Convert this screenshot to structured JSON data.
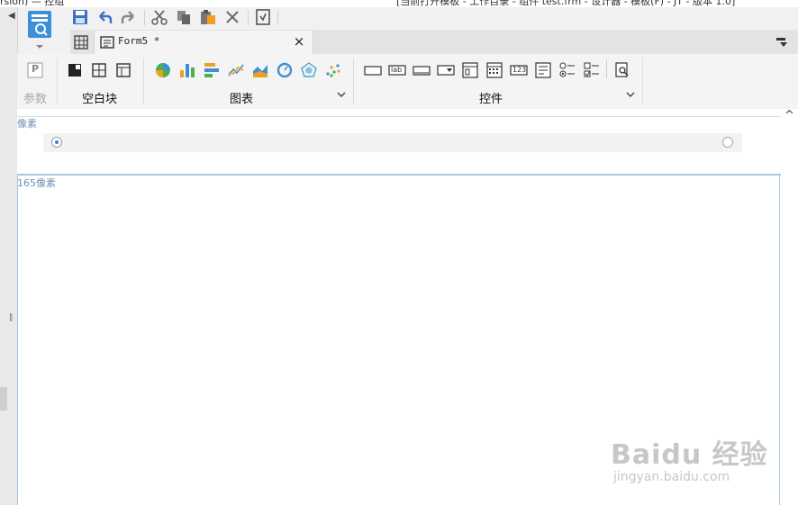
{
  "titlebar": {
    "left_text": "rsion)  — 控组",
    "right_text": "[当前打开模板 - 工作目录 - 组件 test.frm - 设计器 - 模板(F) - JT - 版本 1.0]"
  },
  "tab": {
    "label": "Form5 *",
    "close": "×"
  },
  "ribbon": {
    "param_label": "参数",
    "param_icon_letter": "P",
    "blank_label": "空白块",
    "chart_label": "图表",
    "control_label": "控件",
    "ctrl_lab_text": "lab",
    "ctrl_number_text": "123"
  },
  "canvas": {
    "size_label_1": "像素",
    "size_label_2": "165像素",
    "scroll_up": "^"
  },
  "watermark": {
    "brand": "Baidu 经验",
    "url": "jingyan.baidu.com"
  },
  "colors": {
    "accent": "#3d8fd8",
    "selection": "#a7c7e7",
    "chart_orange": "#f0a020",
    "chart_green": "#4caf50",
    "chart_blue": "#3d8fd8"
  },
  "icons": [
    "save-icon",
    "undo-icon",
    "redo-icon",
    "cut-icon",
    "copy-icon",
    "paste-icon",
    "delete-icon",
    "template-icon",
    "grid-icon",
    "form-icon",
    "close-icon",
    "panel-toggle-icon",
    "parameter-icon",
    "blank-absolute-icon",
    "blank-split-icon",
    "blank-frame-icon",
    "pie-chart-icon",
    "bar-chart-icon",
    "horizontal-bar-icon",
    "line-chart-icon",
    "area-chart-icon",
    "gauge-icon",
    "radar-icon",
    "scatter-icon",
    "textbox-icon",
    "label-icon",
    "button-icon",
    "dropdown-icon",
    "date-icon",
    "calendar-icon",
    "number-icon",
    "listbox-icon",
    "radio-group-icon",
    "checkbox-group-icon",
    "search-icon",
    "chevron-down-icon"
  ]
}
